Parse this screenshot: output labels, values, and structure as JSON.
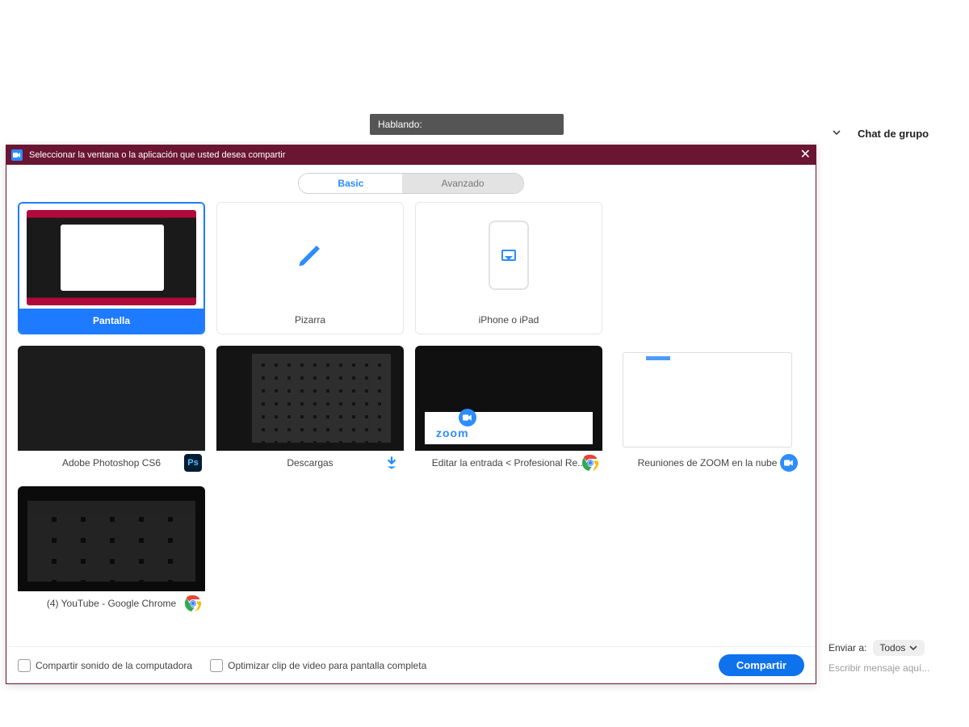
{
  "speaking_label": "Hablando:",
  "chat": {
    "title": "Chat de grupo",
    "send_label": "Enviar a:",
    "send_target": "Todos",
    "placeholder": "Escribir mensaje aquí..."
  },
  "dialog": {
    "title": "Seleccionar la ventana o la aplicación que usted desea compartir",
    "tabs": {
      "basic": "Basic",
      "advanced": "Avanzado"
    },
    "tiles": {
      "screen": "Pantalla",
      "whiteboard": "Pizarra",
      "iphone": "iPhone o iPad",
      "photoshop": "Adobe Photoshop CS6",
      "downloads": "Descargas",
      "chrome_edit": "Editar la entrada < Profesional Re...",
      "zoom_cloud": "Reuniones de ZOOM en la nube",
      "youtube": "(4) YouTube - Google Chrome"
    },
    "footer": {
      "share_audio": "Compartir sonido de la computadora",
      "optimize_video": "Optimizar clip de video para pantalla completa",
      "share_button": "Compartir"
    },
    "zoom_word": "zoom",
    "ps_badge": "Ps"
  }
}
